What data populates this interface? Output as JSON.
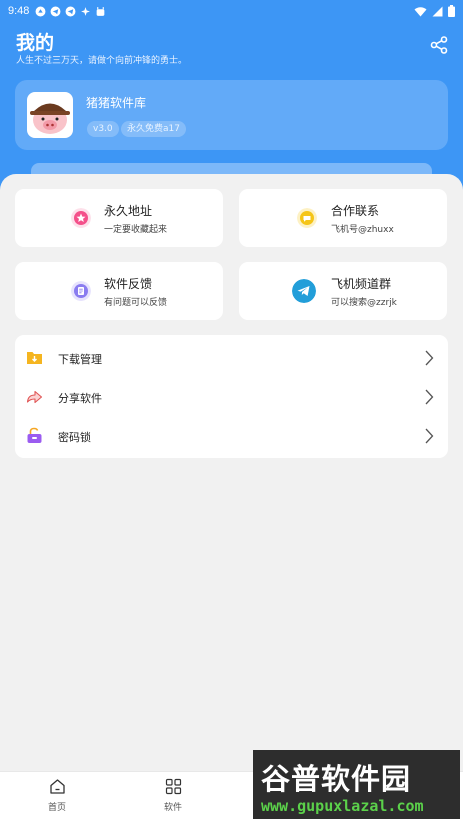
{
  "status_bar": {
    "time": "9:48"
  },
  "header": {
    "title": "我的",
    "subtitle": "人生不过三万天，请做个向前冲锋的勇士。"
  },
  "profile": {
    "app_name": "猪猪软件库",
    "version_badge": "v3.0",
    "free_badge": "永久免费a17"
  },
  "tiles": [
    {
      "name": "永久地址",
      "desc": "一定要收藏起来",
      "icon": "star-icon",
      "color": "#f4508a"
    },
    {
      "name": "合作联系",
      "desc": "飞机号@zhuxx",
      "icon": "chat-icon",
      "color": "#f5c518"
    },
    {
      "name": "软件反馈",
      "desc": "有问题可以反馈",
      "icon": "document-icon",
      "color": "#8a7cf0"
    },
    {
      "name": "飞机频道群",
      "desc": "可以搜索@zzrjk",
      "icon": "telegram-icon",
      "color": "#229ed9"
    }
  ],
  "menu": [
    {
      "label": "下载管理",
      "icon": "download-folder-icon",
      "color": "#f5b520"
    },
    {
      "label": "分享软件",
      "icon": "share-arrow-icon",
      "color": "#f06a6a"
    },
    {
      "label": "密码锁",
      "icon": "lock-icon",
      "color": "#9b5cf0"
    }
  ],
  "tabbar": [
    {
      "label": "首页",
      "icon": "home-icon"
    },
    {
      "label": "软件",
      "icon": "apps-grid-icon"
    }
  ],
  "watermark": {
    "title": "谷普软件园",
    "url": "www.gupuxlazal.com"
  },
  "colors": {
    "header_blue": "#3d96f5",
    "background": "#f1f1f1"
  }
}
